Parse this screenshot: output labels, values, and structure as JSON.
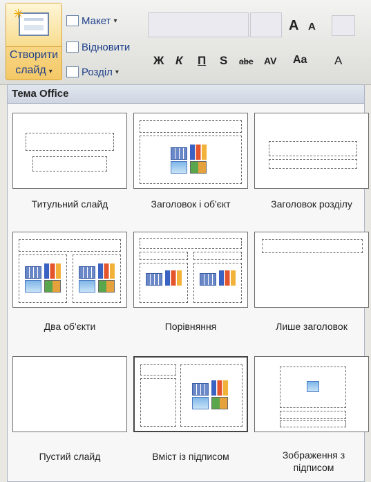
{
  "ribbon": {
    "new_slide_label_1": "Створити",
    "new_slide_label_2": "слайд",
    "layout_label": "Макет",
    "reset_label": "Відновити",
    "section_label": "Розділ",
    "font_increase": "A",
    "font_decrease": "A",
    "bold": "Ж",
    "italic": "К",
    "underline": "П",
    "shadow": "S",
    "strikethrough": "abe",
    "spacing": "AV",
    "change_case": "Aa",
    "font_color": "A"
  },
  "gallery": {
    "title": "Тема Office",
    "layouts": [
      {
        "label": "Титульний слайд"
      },
      {
        "label": "Заголовок і об'єкт"
      },
      {
        "label": "Заголовок розділу"
      },
      {
        "label": "Два об'єкти"
      },
      {
        "label": "Порівняння"
      },
      {
        "label": "Лише заголовок"
      },
      {
        "label": "Пустий слайд"
      },
      {
        "label": "Вміст із підписом"
      },
      {
        "label": "Зображення з підписом"
      }
    ]
  }
}
